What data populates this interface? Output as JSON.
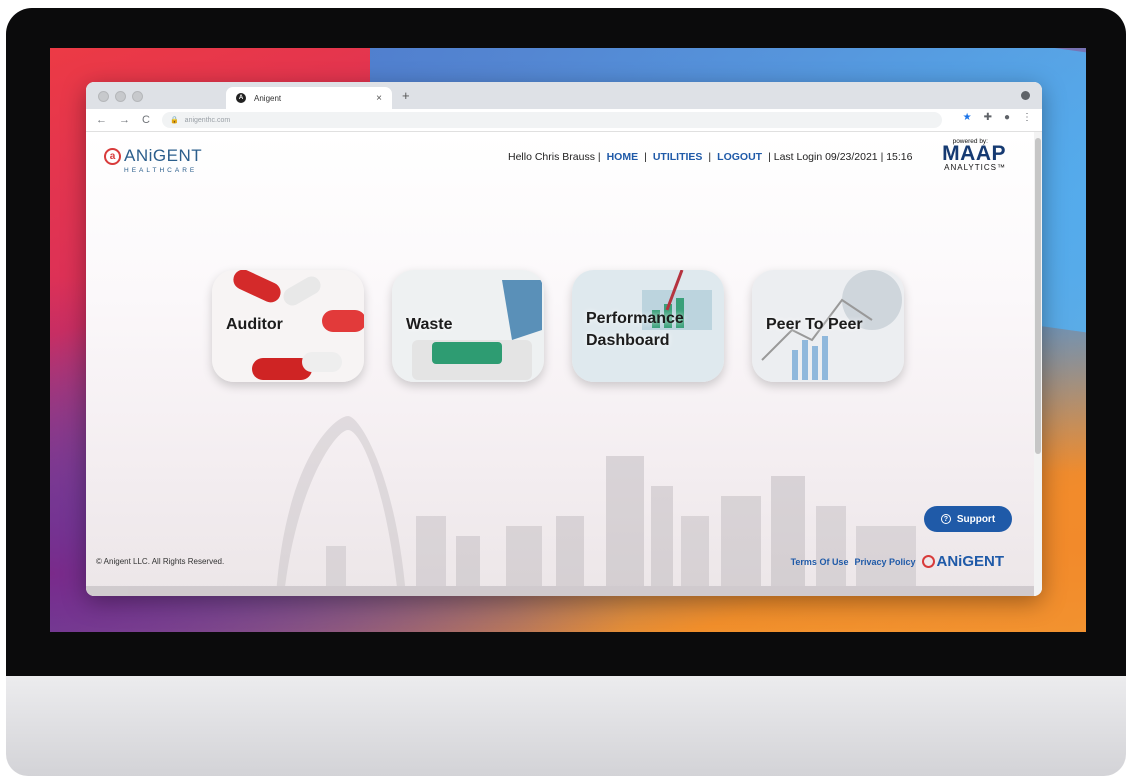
{
  "browser": {
    "tab_title": "Anigent",
    "tab_close": "×",
    "new_tab": "+",
    "url": "anigenthc.com",
    "nav": {
      "back": "←",
      "forward": "→",
      "reload": "C"
    },
    "icons": [
      "star-icon",
      "puzzle-icon",
      "profile-icon",
      "menu-icon"
    ]
  },
  "header": {
    "logo_text": "ANiGENT",
    "logo_sub": "HEALTHCARE",
    "greeting": "Hello Chris Brauss |",
    "home": "HOME",
    "utilities": "UTILITIES",
    "logout": "LOGOUT",
    "sep": "|",
    "last_login": "| Last Login 09/23/2021 | 15:16",
    "powered_by": "powered by:",
    "maap": "MAAP",
    "analytics": "ANALYTICS™"
  },
  "cards": [
    {
      "title": "Auditor"
    },
    {
      "title": "Waste"
    },
    {
      "title": "Performance Dashboard"
    },
    {
      "title": "Peer To Peer"
    }
  ],
  "footer": {
    "copyright": "© Anigent LLC. All Rights Reserved.",
    "support": "Support",
    "terms": "Terms Of Use",
    "privacy": "Privacy Policy",
    "footer_logo": "ANiGENT"
  },
  "colors": {
    "link_blue": "#1f5aa8",
    "logo_red": "#d83b3b"
  }
}
